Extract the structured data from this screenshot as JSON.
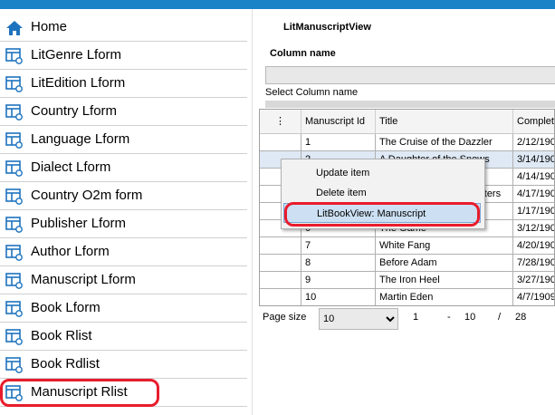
{
  "sidebar": {
    "items": [
      {
        "label": "Home",
        "icon": "home-icon"
      },
      {
        "label": "LitGenre Lform",
        "icon": "form-icon"
      },
      {
        "label": "LitEdition Lform",
        "icon": "form-icon"
      },
      {
        "label": "Country Lform",
        "icon": "form-icon"
      },
      {
        "label": "Language Lform",
        "icon": "form-icon"
      },
      {
        "label": "Dialect Lform",
        "icon": "form-icon"
      },
      {
        "label": "Country O2m form",
        "icon": "form-icon"
      },
      {
        "label": "Publisher Lform",
        "icon": "form-icon"
      },
      {
        "label": "Author Lform",
        "icon": "form-icon"
      },
      {
        "label": "Manuscript Lform",
        "icon": "form-icon"
      },
      {
        "label": "Book Lform",
        "icon": "form-icon"
      },
      {
        "label": "Book Rlist",
        "icon": "form-icon"
      },
      {
        "label": "Book Rdlist",
        "icon": "form-icon"
      },
      {
        "label": "Manuscript Rlist",
        "icon": "form-icon"
      }
    ],
    "highlighted_item": "Manuscript Rlist"
  },
  "main": {
    "title": "LitManuscriptView",
    "column_name_label": "Column name",
    "column_name_value": "",
    "select_hint": "Select Column name"
  },
  "grid": {
    "menu_glyph": "⋮",
    "columns": [
      "",
      "Manuscript Id",
      "Title",
      "Complet"
    ],
    "rows": [
      [
        "",
        "1",
        "The Cruise of the Dazzler",
        "2/12/190"
      ],
      [
        "",
        "2",
        "A Daughter of the Snows",
        "3/14/190"
      ],
      [
        "",
        "3",
        "",
        "4/14/190"
      ],
      [
        "",
        "4",
        "The Kempton-Wace Letters",
        "4/17/190"
      ],
      [
        "",
        "5",
        "",
        "1/17/190"
      ],
      [
        "",
        "6",
        "The Game",
        "3/12/190"
      ],
      [
        "",
        "7",
        "White Fang",
        "4/20/190"
      ],
      [
        "",
        "8",
        "Before Adam",
        "7/28/190"
      ],
      [
        "",
        "9",
        "The Iron Heel",
        "3/27/190"
      ],
      [
        "",
        "10",
        "Martin Eden",
        "4/7/1909"
      ]
    ],
    "selected_row": 1
  },
  "pager": {
    "page_size_label": "Page size",
    "page_size_value": "10",
    "from": "1",
    "dash": "-",
    "to": "10",
    "slash": "/",
    "total": "28"
  },
  "context_menu": {
    "items": [
      "Update item",
      "Delete item",
      "LitBookView: Manuscript"
    ],
    "highlighted": "LitBookView: Manuscript"
  },
  "colors": {
    "topbar": "#1a82c6",
    "icon_blue": "#1e73be",
    "annotation_red": "#e81c2c",
    "menu_highlight": "#cde0f3"
  }
}
